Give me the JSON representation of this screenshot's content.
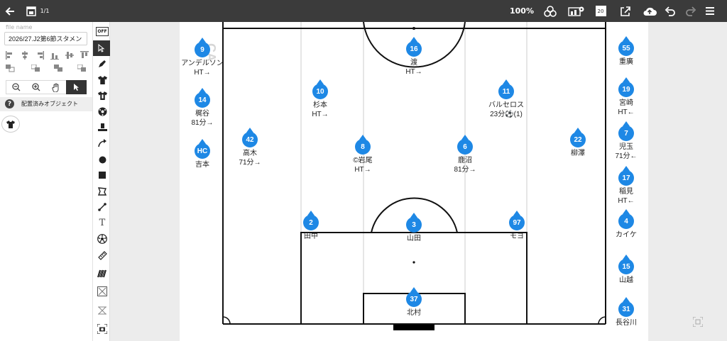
{
  "topbar": {
    "back_icon": "arrow-left-icon",
    "calendar_icon": "calendar-icon",
    "page_counter": "1/1",
    "zoom": "100%",
    "share_icon": "share-icon",
    "settings_icon": "formation-settings-icon",
    "size_badge": "20",
    "export_icon": "export-icon",
    "cloud_icon": "cloud-upload-icon",
    "undo_icon": "undo-icon",
    "redo_icon": "redo-icon",
    "menu_icon": "menu-icon"
  },
  "left_panel": {
    "file_label": "file name",
    "file_value": "2026/27.J2第6節スタメン",
    "placed_objects_label": "配置済みオブジェクト"
  },
  "tools": {
    "off_label": "OFF",
    "text_tool_label": "T"
  },
  "field": {
    "watermark": "CA"
  },
  "players": [
    {
      "num": "16",
      "name": "渡",
      "note": "HT→"
    },
    {
      "num": "9",
      "name": "アンデルソン",
      "note": "HT→"
    },
    {
      "num": "14",
      "name": "梶谷",
      "note": "81分→"
    },
    {
      "num": "HC",
      "name": "吉本",
      "note": ""
    },
    {
      "num": "10",
      "name": "杉本",
      "note": "HT→"
    },
    {
      "num": "11",
      "name": "バルセロス",
      "note": "23分⚽(1)"
    },
    {
      "num": "42",
      "name": "高木",
      "note": "71分→"
    },
    {
      "num": "8",
      "name": "©岩尾",
      "note": "HT→"
    },
    {
      "num": "6",
      "name": "鹿沼",
      "note": "81分→"
    },
    {
      "num": "22",
      "name": "柳澤",
      "note": ""
    },
    {
      "num": "2",
      "name": "田中",
      "note": ""
    },
    {
      "num": "3",
      "name": "山田",
      "note": ""
    },
    {
      "num": "97",
      "name": "モヨ",
      "note": ""
    },
    {
      "num": "37",
      "name": "北村",
      "note": ""
    },
    {
      "num": "55",
      "name": "重廣",
      "note": ""
    },
    {
      "num": "19",
      "name": "宮崎",
      "note": "HT←"
    },
    {
      "num": "7",
      "name": "児玉",
      "note": "71分←"
    },
    {
      "num": "17",
      "name": "稲見",
      "note": "HT←"
    },
    {
      "num": "4",
      "name": "カイケ",
      "note": ""
    },
    {
      "num": "15",
      "name": "山越",
      "note": ""
    },
    {
      "num": "31",
      "name": "長谷川",
      "note": ""
    }
  ]
}
